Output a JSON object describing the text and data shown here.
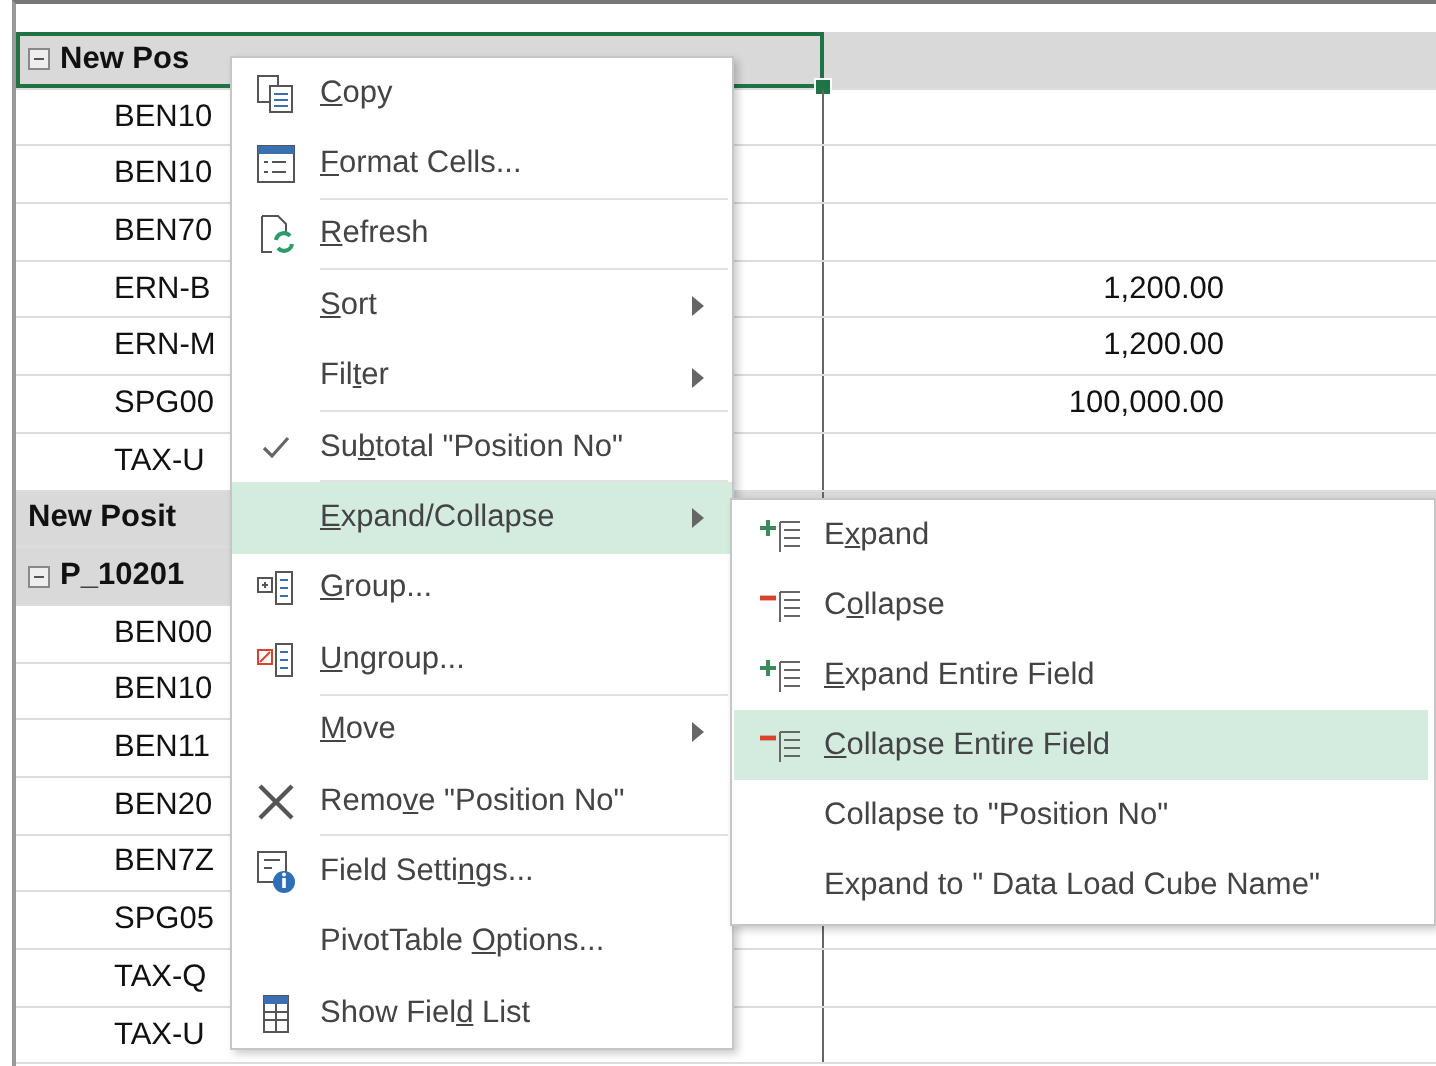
{
  "sheet": {
    "rows": [
      {
        "kind": "group",
        "label": "New Pos",
        "selected": true,
        "toggle": true
      },
      {
        "kind": "item",
        "label": "BEN10",
        "selected": false,
        "toggle": false
      },
      {
        "kind": "item",
        "label": "BEN10",
        "selected": false,
        "toggle": false
      },
      {
        "kind": "item",
        "label": "BEN70",
        "selected": false,
        "toggle": false
      },
      {
        "kind": "item",
        "label": "ERN-B",
        "value": "1,200.00",
        "selected": false,
        "toggle": false
      },
      {
        "kind": "item",
        "label": "ERN-M",
        "value": "1,200.00",
        "selected": false,
        "toggle": false
      },
      {
        "kind": "item",
        "label": "SPG00",
        "value": "100,000.00",
        "selected": false,
        "toggle": false
      },
      {
        "kind": "item",
        "label": "TAX-U",
        "selected": false,
        "toggle": false
      },
      {
        "kind": "group",
        "label": "New Posit",
        "selected": false,
        "toggle": false
      },
      {
        "kind": "group",
        "label": "P_10201",
        "selected": false,
        "toggle": true
      },
      {
        "kind": "item",
        "label": "BEN00",
        "selected": false,
        "toggle": false
      },
      {
        "kind": "item",
        "label": "BEN10",
        "selected": false,
        "toggle": false
      },
      {
        "kind": "item",
        "label": "BEN11",
        "selected": false,
        "toggle": false
      },
      {
        "kind": "item",
        "label": "BEN20",
        "selected": false,
        "toggle": false
      },
      {
        "kind": "item",
        "label": "BEN7Z",
        "selected": false,
        "toggle": false
      },
      {
        "kind": "item",
        "label": "SPG05",
        "selected": false,
        "toggle": false
      },
      {
        "kind": "item",
        "label": "TAX-Q",
        "selected": false,
        "toggle": false
      },
      {
        "kind": "item",
        "label": "TAX-U",
        "selected": false,
        "toggle": false
      }
    ]
  },
  "context_menu": {
    "items": [
      {
        "kind": "copy",
        "key": "C",
        "post": "opy",
        "submenu": false,
        "checked": false,
        "selected": false,
        "separator_after": false
      },
      {
        "kind": "format",
        "key": "F",
        "post": "ormat Cells...",
        "submenu": false,
        "checked": false,
        "selected": false,
        "separator_after": true
      },
      {
        "kind": "refresh",
        "key": "R",
        "post": "efresh",
        "submenu": false,
        "checked": false,
        "selected": false,
        "separator_after": true
      },
      {
        "kind": "plain",
        "key": "S",
        "post": "ort",
        "submenu": true,
        "checked": false,
        "selected": false,
        "separator_after": false
      },
      {
        "kind": "plain",
        "pre": "Fil",
        "key": "t",
        "post": "er",
        "submenu": true,
        "checked": false,
        "selected": false,
        "separator_after": true
      },
      {
        "kind": "plain",
        "pre": "Su",
        "key": "b",
        "post": "total \"Position No\"",
        "submenu": false,
        "checked": true,
        "selected": false,
        "separator_after": true
      },
      {
        "kind": "plain",
        "key": "E",
        "post": "xpand/Collapse",
        "submenu": true,
        "checked": false,
        "selected": true,
        "separator_after": false
      },
      {
        "kind": "group",
        "key": "G",
        "post": "roup...",
        "submenu": false,
        "checked": false,
        "selected": false,
        "separator_after": false
      },
      {
        "kind": "ungroup",
        "key": "U",
        "post": "ngroup...",
        "submenu": false,
        "checked": false,
        "selected": false,
        "separator_after": true
      },
      {
        "kind": "plain",
        "key": "M",
        "post": "ove",
        "submenu": true,
        "checked": false,
        "selected": false,
        "separator_after": false
      },
      {
        "kind": "remove",
        "pre": "Remo",
        "key": "v",
        "post": "e \"Position No\"",
        "submenu": false,
        "checked": false,
        "selected": false,
        "separator_after": true
      },
      {
        "kind": "settings",
        "pre": "Field Setti",
        "key": "n",
        "post": "gs...",
        "submenu": false,
        "checked": false,
        "selected": false,
        "separator_after": false
      },
      {
        "kind": "plain",
        "pre": "PivotTable ",
        "key": "O",
        "post": "ptions...",
        "submenu": false,
        "checked": false,
        "selected": false,
        "separator_after": false
      },
      {
        "kind": "fieldlist",
        "pre": "Show Fiel",
        "key": "d",
        "post": " List",
        "submenu": false,
        "checked": false,
        "selected": false,
        "separator_after": false
      }
    ]
  },
  "submenu": {
    "items": [
      {
        "kind": "expand",
        "pre": "E",
        "key": "x",
        "post": "pand",
        "selected": false
      },
      {
        "kind": "collapse",
        "pre": "C",
        "key": "o",
        "post": "llapse",
        "selected": false
      },
      {
        "kind": "expand",
        "key": "E",
        "post": "xpand Entire Field",
        "selected": false
      },
      {
        "kind": "collapse",
        "key": "C",
        "post": "ollapse Entire Field",
        "selected": true
      },
      {
        "kind": "plain",
        "pre": "Collapse to \"Position No\"",
        "selected": false
      },
      {
        "kind": "plain",
        "pre": "Expand to \" Data Load Cube Name\"",
        "selected": false
      }
    ]
  }
}
